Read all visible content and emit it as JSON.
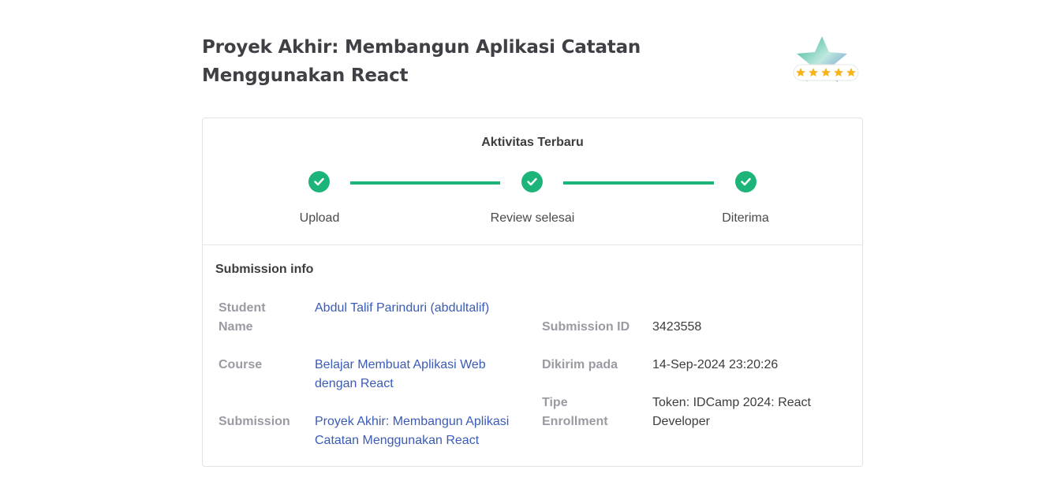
{
  "page": {
    "title": "Proyek Akhir: Membangun Aplikasi Catatan Menggunakan React"
  },
  "rating": {
    "stars": 5,
    "icon": "star-badge-icon",
    "accent": "#f5b61d"
  },
  "activity": {
    "title": "Aktivitas Terbaru",
    "color": "#1db47a",
    "steps": [
      {
        "label": "Upload",
        "status": "done"
      },
      {
        "label": "Review selesai",
        "status": "done"
      },
      {
        "label": "Diterima",
        "status": "done"
      }
    ]
  },
  "submission_info": {
    "title": "Submission info",
    "student_name_label": "Student Name",
    "student_name_value": "Abdul Talif Parinduri (abdultalif)",
    "course_label": "Course",
    "course_value": "Belajar Membuat Aplikasi Web dengan React",
    "submission_label": "Submission",
    "submission_value": "Proyek Akhir: Membangun Aplikasi Catatan Menggunakan React",
    "submission_id_label": "Submission ID",
    "submission_id_value": "3423558",
    "sent_label": "Dikirim pada",
    "sent_value": "14-Sep-2024 23:20:26",
    "enrollment_label": "Tipe Enrollment",
    "enrollment_value": "Token: IDCamp 2024: React Developer"
  }
}
